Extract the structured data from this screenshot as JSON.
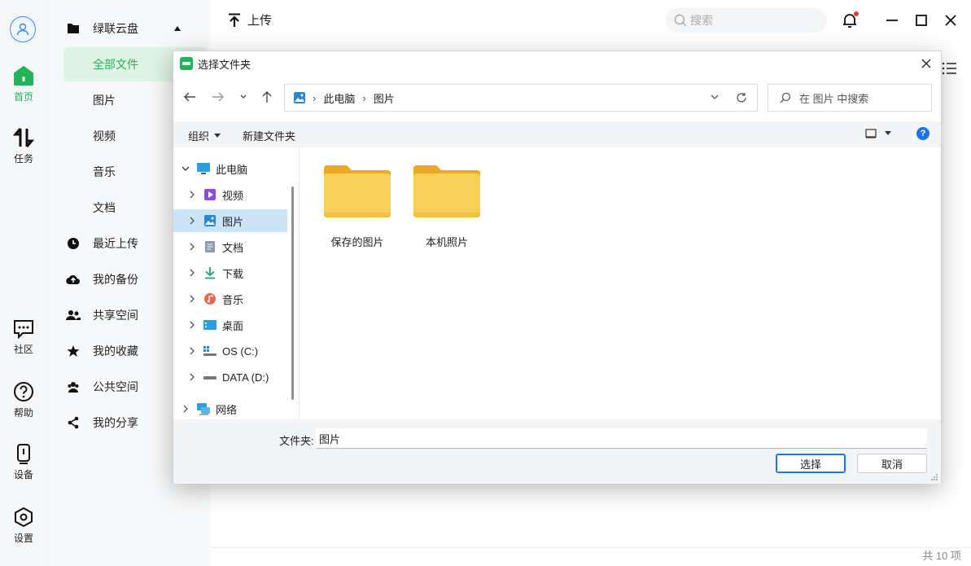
{
  "rail": {
    "items": [
      {
        "label": "首页",
        "icon": "home-icon",
        "active": true
      },
      {
        "label": "任务",
        "icon": "transfer-icon"
      },
      {
        "label": "社区",
        "icon": "chat-icon"
      },
      {
        "label": "帮助",
        "icon": "help-icon"
      },
      {
        "label": "设备",
        "icon": "device-icon"
      },
      {
        "label": "设置",
        "icon": "settings-icon"
      }
    ]
  },
  "sidebar": {
    "cloud": "绿联云盘",
    "sub": [
      "全部文件",
      "图片",
      "视频",
      "音乐",
      "文档"
    ],
    "items": [
      "最近上传",
      "我的备份",
      "共享空间",
      "我的收藏",
      "公共空间",
      "我的分享"
    ]
  },
  "header": {
    "upload": "上传",
    "search_placeholder": "搜索"
  },
  "footer": {
    "count": "共 10 项"
  },
  "dialog": {
    "title": "选择文件夹",
    "address": [
      "此电脑",
      "图片"
    ],
    "search_placeholder": "在 图片 中搜索",
    "organize": "组织",
    "new_folder": "新建文件夹",
    "help": "?",
    "tree": [
      {
        "label": "此电脑",
        "expanded": true,
        "icon": "pc-icon"
      },
      {
        "label": "视频",
        "icon": "video-folder-icon"
      },
      {
        "label": "图片",
        "icon": "pictures-folder-icon",
        "selected": true
      },
      {
        "label": "文档",
        "icon": "documents-folder-icon"
      },
      {
        "label": "下载",
        "icon": "downloads-folder-icon"
      },
      {
        "label": "音乐",
        "icon": "music-folder-icon"
      },
      {
        "label": "桌面",
        "icon": "desktop-folder-icon"
      },
      {
        "label": "OS (C:)",
        "icon": "drive-c-icon"
      },
      {
        "label": "DATA (D:)",
        "icon": "drive-d-icon"
      },
      {
        "label": "网络",
        "icon": "network-icon"
      }
    ],
    "folders": [
      "保存的图片",
      "本机照片"
    ],
    "filename_label": "文件夹:",
    "filename_value": "图片",
    "select": "选择",
    "cancel": "取消"
  },
  "colors": {
    "accent": "#25b05a",
    "selected": "#cce4f7",
    "link": "#1a73e8",
    "folder": "#f6c343"
  }
}
